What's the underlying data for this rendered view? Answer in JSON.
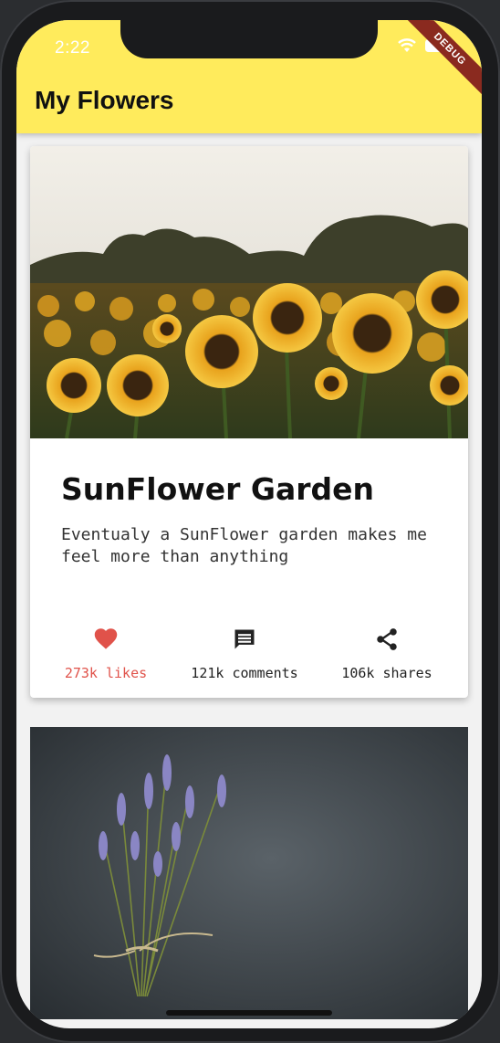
{
  "status_bar": {
    "time": "2:22",
    "debug_label": "DEBUG"
  },
  "app_bar": {
    "title": "My Flowers",
    "background": "#ffeb5c"
  },
  "cards": [
    {
      "image": "sunflower-field-photo",
      "title": "SunFlower Garden",
      "description": "Eventualy a SunFlower garden makes me feel more than anything",
      "actions": [
        {
          "icon": "heart-icon",
          "label": "273k likes",
          "color": "#e0524a"
        },
        {
          "icon": "comment-icon",
          "label": "121k comments",
          "color": "#222222"
        },
        {
          "icon": "share-icon",
          "label": "106k shares",
          "color": "#222222"
        }
      ]
    },
    {
      "image": "lavender-bouquet-photo"
    }
  ]
}
